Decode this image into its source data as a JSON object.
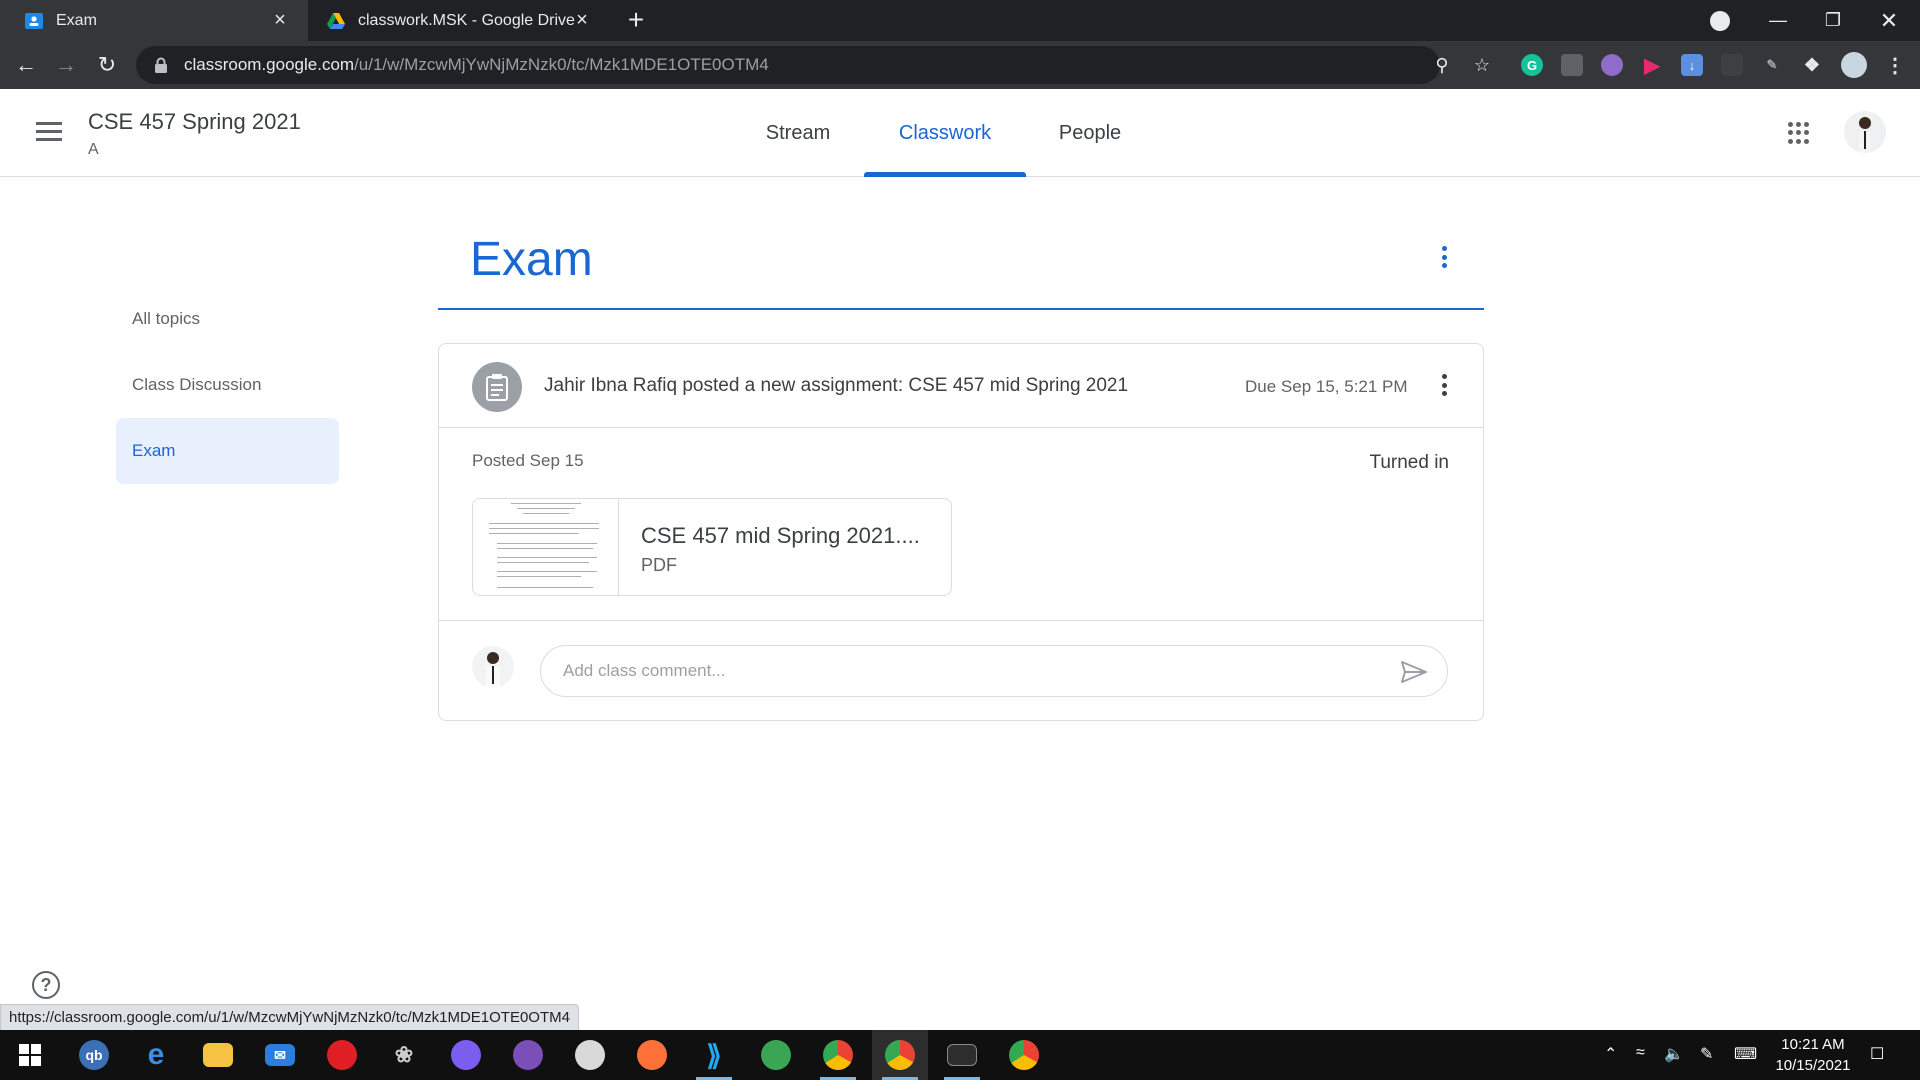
{
  "browser": {
    "tabs": [
      {
        "title": "Exam",
        "active": true
      },
      {
        "title": "classwork.MSK - Google Drive",
        "active": false
      }
    ],
    "url_host": "classroom.google.com",
    "url_path": "/u/1/w/MzcwMjYwNjMzNzk0/tc/Mzk1MDE1OTE0OTM4",
    "status_url": "https://classroom.google.com/u/1/w/MzcwMjYwNjMzNzk0/tc/Mzk1MDE1OTE0OTM4"
  },
  "header": {
    "class_title": "CSE 457 Spring 2021",
    "section": "A",
    "tabs": [
      "Stream",
      "Classwork",
      "People"
    ],
    "active_tab": "Classwork",
    "accent": "#1967d2"
  },
  "sidebar": {
    "items": [
      {
        "label": "All topics",
        "active": false
      },
      {
        "label": "Class Discussion",
        "active": false
      },
      {
        "label": "Exam",
        "active": true
      }
    ]
  },
  "topic": {
    "title": "Exam"
  },
  "assignment": {
    "headline": "Jahir Ibna Rafiq posted a new assignment: CSE 457 mid Spring 2021",
    "due": "Due Sep 15, 5:21 PM",
    "posted": "Posted Sep 15",
    "status": "Turned in",
    "attachment": {
      "name": "CSE 457 mid Spring 2021....",
      "type": "PDF"
    }
  },
  "comment": {
    "placeholder": "Add class comment..."
  },
  "taskbar": {
    "time": "10:21 AM",
    "date": "10/15/2021"
  }
}
